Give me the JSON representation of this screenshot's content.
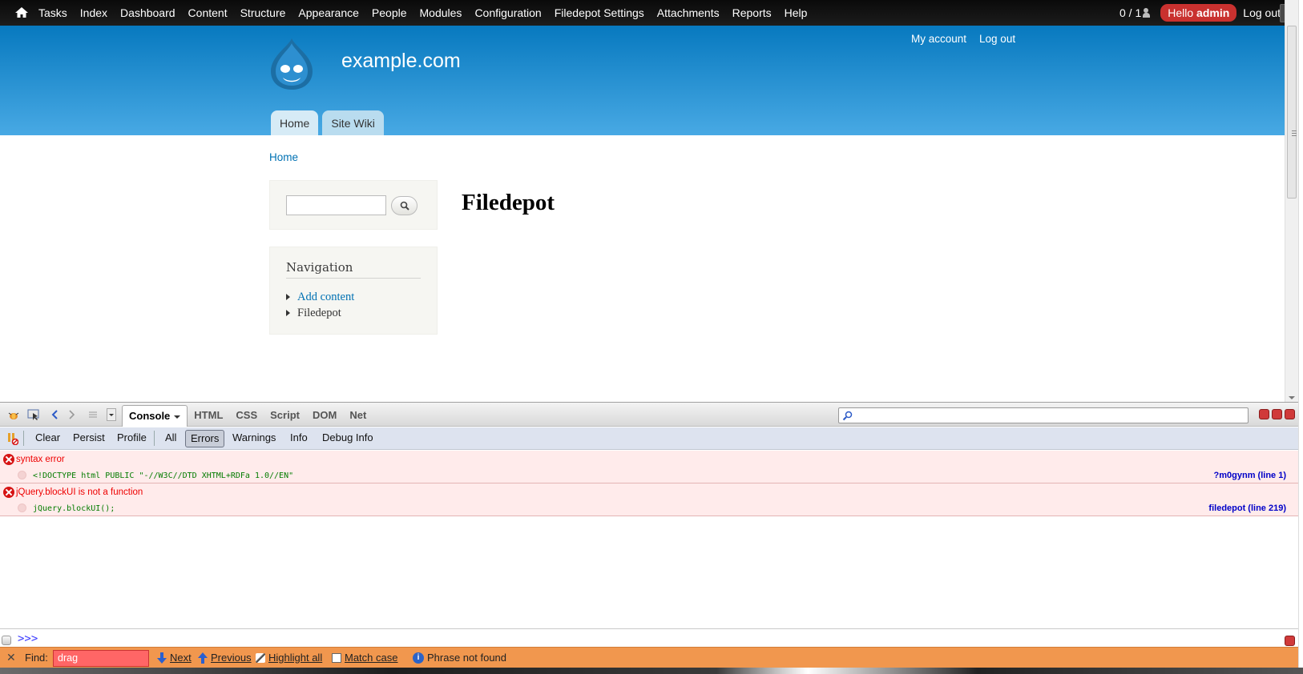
{
  "toolbar": {
    "menu": [
      "Tasks",
      "Index",
      "Dashboard",
      "Content",
      "Structure",
      "Appearance",
      "People",
      "Modules",
      "Configuration",
      "Filedepot Settings",
      "Attachments",
      "Reports",
      "Help"
    ],
    "users_count": "0 / 1",
    "hello_prefix": "Hello",
    "hello_user": "admin",
    "logout": "Log out"
  },
  "header": {
    "secondary_links": [
      "My account",
      "Log out"
    ],
    "site_name": "example.com",
    "tabs": [
      "Home",
      "Site Wiki"
    ]
  },
  "breadcrumb": "Home",
  "sidebar": {
    "nav_title": "Navigation",
    "nav_items": [
      {
        "label": "Add content",
        "link": true
      },
      {
        "label": "Filedepot",
        "link": false
      }
    ]
  },
  "main": {
    "title": "Filedepot"
  },
  "firebug": {
    "tabs": [
      "Console",
      "HTML",
      "CSS",
      "Script",
      "DOM",
      "Net"
    ],
    "console_toolbar": [
      "Clear",
      "Persist",
      "Profile",
      "All",
      "Errors",
      "Warnings",
      "Info",
      "Debug Info"
    ],
    "errors": [
      {
        "message": "syntax error",
        "code": "<!DOCTYPE html PUBLIC \"-//W3C//DTD XHTML+RDFa 1.0//EN\"",
        "source": "?m0gynm (line 1)"
      },
      {
        "message": "jQuery.blockUI is not a function",
        "code": "jQuery.blockUI();",
        "source": "filedepot (line 219)"
      }
    ],
    "command_prompt": ">>>"
  },
  "findbar": {
    "label": "Find:",
    "value": "drag",
    "next": "Next",
    "previous": "Previous",
    "highlight": "Highlight all",
    "match_case": "Match case",
    "status": "Phrase not found"
  },
  "colors": {
    "toolbar_bg": "#111111",
    "header_top": "#0779bf",
    "header_bottom": "#48a9e4",
    "link": "#0071b3",
    "error_bg": "#ffebeb",
    "findbar_bg": "#f1974e"
  }
}
